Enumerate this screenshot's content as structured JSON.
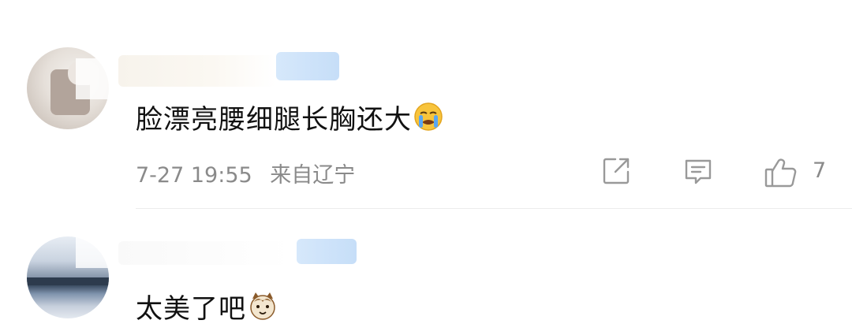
{
  "comments": [
    {
      "text": "脸漂亮腰细腿长胸还大",
      "emoji": "crying-face-emoji",
      "timestamp": "7-27 19:55",
      "location": "来自辽宁",
      "likes": "7"
    },
    {
      "text": "太美了吧",
      "emoji": "cat-face-emoji"
    }
  ],
  "colors": {
    "text": "#111111",
    "meta": "#8a8a8a",
    "icon": "#999999",
    "badge": "#c6def8"
  }
}
